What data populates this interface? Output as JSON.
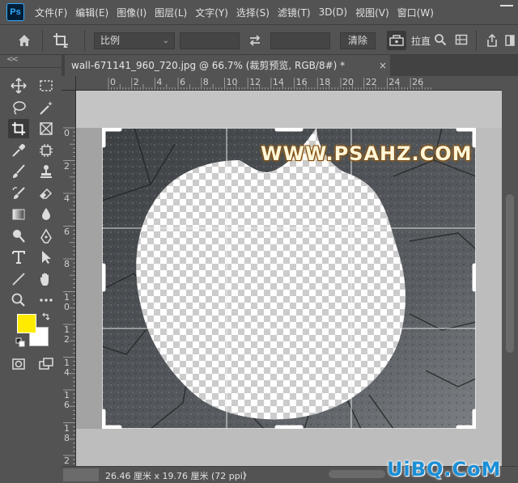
{
  "app": {
    "logo": "Ps"
  },
  "menu": [
    "文件(F)",
    "编辑(E)",
    "图像(I)",
    "图层(L)",
    "文字(Y)",
    "选择(S)",
    "滤镜(T)",
    "3D(D)",
    "视图(V)",
    "窗口(W)"
  ],
  "options": {
    "ratio_value": "比例",
    "clear_label": "清除",
    "straighten_label": "拉直"
  },
  "toolbar": {
    "collapse": "<<",
    "fg_color": "#ffeb00",
    "bg_color": "#ffffff"
  },
  "document": {
    "tab_title": "wall-671141_960_720.jpg @ 66.7% (裁剪预览, RGB/8#) *",
    "close_glyph": "×"
  },
  "rulers": {
    "top": [
      "0",
      "2",
      "4",
      "6",
      "8",
      "10",
      "12",
      "14",
      "16",
      "18",
      "20",
      "22",
      "24",
      "26"
    ],
    "left": [
      "0",
      "2",
      "4",
      "6",
      "8",
      "1\n0",
      "1\n2",
      "1\n4",
      "1\n6",
      "1\n8",
      "2\n0"
    ]
  },
  "canvas": {
    "watermark": "WWW.PSAHZ.COM"
  },
  "status": {
    "dimensions": "26.46 厘米 x 19.76 厘米 (72 ppi)",
    "arrow": "〉"
  },
  "site_logo": "UiBQ.CoM"
}
